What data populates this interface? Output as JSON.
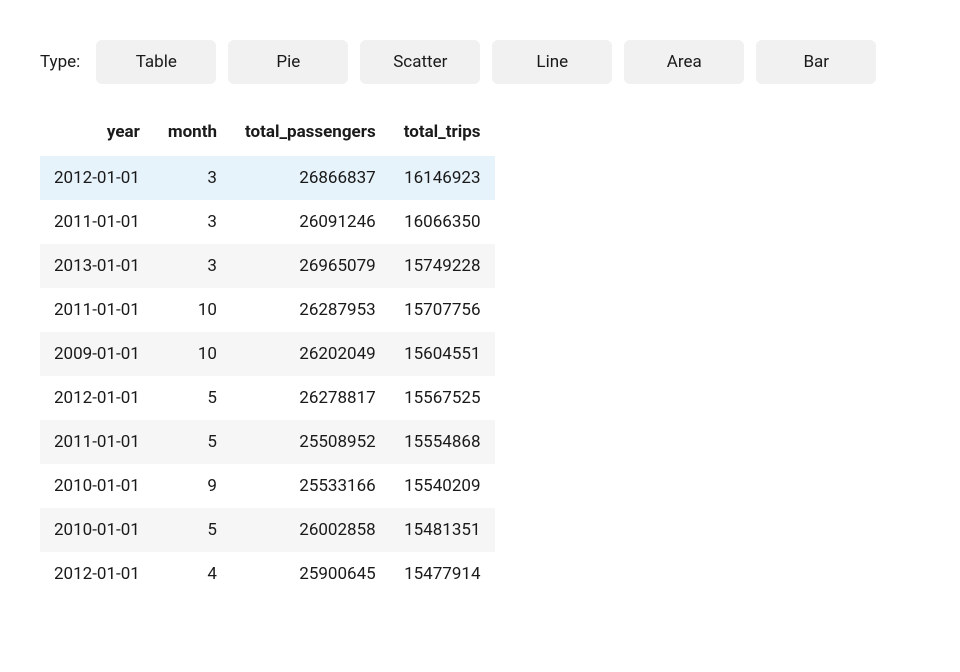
{
  "toolbar": {
    "type_label": "Type:",
    "buttons": [
      "Table",
      "Pie",
      "Scatter",
      "Line",
      "Area",
      "Bar"
    ]
  },
  "table": {
    "columns": [
      "year",
      "month",
      "total_passengers",
      "total_trips"
    ],
    "rows": [
      {
        "year": "2012-01-01",
        "month": "3",
        "total_passengers": "26866837",
        "total_trips": "16146923",
        "highlighted": true
      },
      {
        "year": "2011-01-01",
        "month": "3",
        "total_passengers": "26091246",
        "total_trips": "16066350",
        "highlighted": false
      },
      {
        "year": "2013-01-01",
        "month": "3",
        "total_passengers": "26965079",
        "total_trips": "15749228",
        "highlighted": false
      },
      {
        "year": "2011-01-01",
        "month": "10",
        "total_passengers": "26287953",
        "total_trips": "15707756",
        "highlighted": false
      },
      {
        "year": "2009-01-01",
        "month": "10",
        "total_passengers": "26202049",
        "total_trips": "15604551",
        "highlighted": false
      },
      {
        "year": "2012-01-01",
        "month": "5",
        "total_passengers": "26278817",
        "total_trips": "15567525",
        "highlighted": false
      },
      {
        "year": "2011-01-01",
        "month": "5",
        "total_passengers": "25508952",
        "total_trips": "15554868",
        "highlighted": false
      },
      {
        "year": "2010-01-01",
        "month": "9",
        "total_passengers": "25533166",
        "total_trips": "15540209",
        "highlighted": false
      },
      {
        "year": "2010-01-01",
        "month": "5",
        "total_passengers": "26002858",
        "total_trips": "15481351",
        "highlighted": false
      },
      {
        "year": "2012-01-01",
        "month": "4",
        "total_passengers": "25900645",
        "total_trips": "15477914",
        "highlighted": false
      }
    ]
  },
  "chart_data": {
    "type": "table",
    "columns": [
      "year",
      "month",
      "total_passengers",
      "total_trips"
    ],
    "rows": [
      [
        "2012-01-01",
        3,
        26866837,
        16146923
      ],
      [
        "2011-01-01",
        3,
        26091246,
        16066350
      ],
      [
        "2013-01-01",
        3,
        26965079,
        15749228
      ],
      [
        "2011-01-01",
        10,
        26287953,
        15707756
      ],
      [
        "2009-01-01",
        10,
        26202049,
        15604551
      ],
      [
        "2012-01-01",
        5,
        26278817,
        15567525
      ],
      [
        "2011-01-01",
        5,
        25508952,
        15554868
      ],
      [
        "2010-01-01",
        9,
        25533166,
        15540209
      ],
      [
        "2010-01-01",
        5,
        26002858,
        15481351
      ],
      [
        "2012-01-01",
        4,
        25900645,
        15477914
      ]
    ]
  }
}
